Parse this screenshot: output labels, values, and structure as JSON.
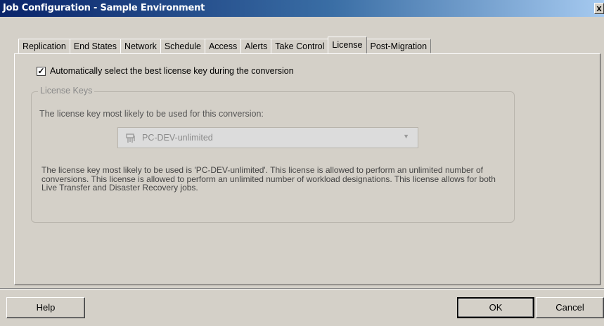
{
  "window": {
    "title": "Job Configuration - Sample Environment",
    "close_label": "x"
  },
  "tabs": [
    {
      "label": "Replication"
    },
    {
      "label": "End States"
    },
    {
      "label": "Network"
    },
    {
      "label": "Schedule"
    },
    {
      "label": "Access"
    },
    {
      "label": "Alerts"
    },
    {
      "label": "Take Control"
    },
    {
      "label": "License",
      "active": true
    },
    {
      "label": "Post-Migration"
    }
  ],
  "license": {
    "auto_select_label": "Automatically select the best license key during the conversion",
    "auto_select_checked": true,
    "group_title": "License Keys",
    "subtitle": "The license key most likely to be used for this conversion:",
    "selected_key": "PC-DEV-unlimited",
    "description": "The license key most likely to be used is 'PC-DEV-unlimited'. This license is allowed to perform an unlimited number of conversions. This license is allowed to perform an unlimited number of workload designations. This license allows for both Live Transfer and Disaster Recovery jobs."
  },
  "buttons": {
    "help": "Help",
    "ok": "OK",
    "cancel": "Cancel"
  },
  "icons": {
    "license_key": "key-icon",
    "dropdown": "chevron-down-icon",
    "close": "close-icon"
  }
}
